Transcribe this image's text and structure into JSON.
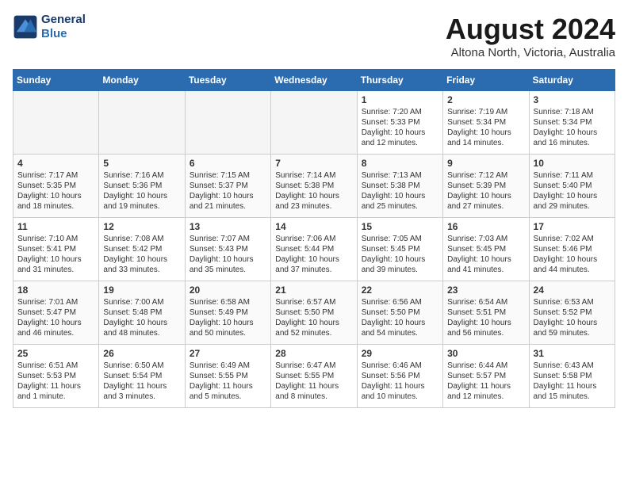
{
  "header": {
    "logo_line1": "General",
    "logo_line2": "Blue",
    "month_title": "August 2024",
    "subtitle": "Altona North, Victoria, Australia"
  },
  "days_of_week": [
    "Sunday",
    "Monday",
    "Tuesday",
    "Wednesday",
    "Thursday",
    "Friday",
    "Saturday"
  ],
  "weeks": [
    [
      {
        "day": "",
        "content": ""
      },
      {
        "day": "",
        "content": ""
      },
      {
        "day": "",
        "content": ""
      },
      {
        "day": "",
        "content": ""
      },
      {
        "day": "1",
        "content": "Sunrise: 7:20 AM\nSunset: 5:33 PM\nDaylight: 10 hours\nand 12 minutes."
      },
      {
        "day": "2",
        "content": "Sunrise: 7:19 AM\nSunset: 5:34 PM\nDaylight: 10 hours\nand 14 minutes."
      },
      {
        "day": "3",
        "content": "Sunrise: 7:18 AM\nSunset: 5:34 PM\nDaylight: 10 hours\nand 16 minutes."
      }
    ],
    [
      {
        "day": "4",
        "content": "Sunrise: 7:17 AM\nSunset: 5:35 PM\nDaylight: 10 hours\nand 18 minutes."
      },
      {
        "day": "5",
        "content": "Sunrise: 7:16 AM\nSunset: 5:36 PM\nDaylight: 10 hours\nand 19 minutes."
      },
      {
        "day": "6",
        "content": "Sunrise: 7:15 AM\nSunset: 5:37 PM\nDaylight: 10 hours\nand 21 minutes."
      },
      {
        "day": "7",
        "content": "Sunrise: 7:14 AM\nSunset: 5:38 PM\nDaylight: 10 hours\nand 23 minutes."
      },
      {
        "day": "8",
        "content": "Sunrise: 7:13 AM\nSunset: 5:38 PM\nDaylight: 10 hours\nand 25 minutes."
      },
      {
        "day": "9",
        "content": "Sunrise: 7:12 AM\nSunset: 5:39 PM\nDaylight: 10 hours\nand 27 minutes."
      },
      {
        "day": "10",
        "content": "Sunrise: 7:11 AM\nSunset: 5:40 PM\nDaylight: 10 hours\nand 29 minutes."
      }
    ],
    [
      {
        "day": "11",
        "content": "Sunrise: 7:10 AM\nSunset: 5:41 PM\nDaylight: 10 hours\nand 31 minutes."
      },
      {
        "day": "12",
        "content": "Sunrise: 7:08 AM\nSunset: 5:42 PM\nDaylight: 10 hours\nand 33 minutes."
      },
      {
        "day": "13",
        "content": "Sunrise: 7:07 AM\nSunset: 5:43 PM\nDaylight: 10 hours\nand 35 minutes."
      },
      {
        "day": "14",
        "content": "Sunrise: 7:06 AM\nSunset: 5:44 PM\nDaylight: 10 hours\nand 37 minutes."
      },
      {
        "day": "15",
        "content": "Sunrise: 7:05 AM\nSunset: 5:45 PM\nDaylight: 10 hours\nand 39 minutes."
      },
      {
        "day": "16",
        "content": "Sunrise: 7:03 AM\nSunset: 5:45 PM\nDaylight: 10 hours\nand 41 minutes."
      },
      {
        "day": "17",
        "content": "Sunrise: 7:02 AM\nSunset: 5:46 PM\nDaylight: 10 hours\nand 44 minutes."
      }
    ],
    [
      {
        "day": "18",
        "content": "Sunrise: 7:01 AM\nSunset: 5:47 PM\nDaylight: 10 hours\nand 46 minutes."
      },
      {
        "day": "19",
        "content": "Sunrise: 7:00 AM\nSunset: 5:48 PM\nDaylight: 10 hours\nand 48 minutes."
      },
      {
        "day": "20",
        "content": "Sunrise: 6:58 AM\nSunset: 5:49 PM\nDaylight: 10 hours\nand 50 minutes."
      },
      {
        "day": "21",
        "content": "Sunrise: 6:57 AM\nSunset: 5:50 PM\nDaylight: 10 hours\nand 52 minutes."
      },
      {
        "day": "22",
        "content": "Sunrise: 6:56 AM\nSunset: 5:50 PM\nDaylight: 10 hours\nand 54 minutes."
      },
      {
        "day": "23",
        "content": "Sunrise: 6:54 AM\nSunset: 5:51 PM\nDaylight: 10 hours\nand 56 minutes."
      },
      {
        "day": "24",
        "content": "Sunrise: 6:53 AM\nSunset: 5:52 PM\nDaylight: 10 hours\nand 59 minutes."
      }
    ],
    [
      {
        "day": "25",
        "content": "Sunrise: 6:51 AM\nSunset: 5:53 PM\nDaylight: 11 hours\nand 1 minute."
      },
      {
        "day": "26",
        "content": "Sunrise: 6:50 AM\nSunset: 5:54 PM\nDaylight: 11 hours\nand 3 minutes."
      },
      {
        "day": "27",
        "content": "Sunrise: 6:49 AM\nSunset: 5:55 PM\nDaylight: 11 hours\nand 5 minutes."
      },
      {
        "day": "28",
        "content": "Sunrise: 6:47 AM\nSunset: 5:55 PM\nDaylight: 11 hours\nand 8 minutes."
      },
      {
        "day": "29",
        "content": "Sunrise: 6:46 AM\nSunset: 5:56 PM\nDaylight: 11 hours\nand 10 minutes."
      },
      {
        "day": "30",
        "content": "Sunrise: 6:44 AM\nSunset: 5:57 PM\nDaylight: 11 hours\nand 12 minutes."
      },
      {
        "day": "31",
        "content": "Sunrise: 6:43 AM\nSunset: 5:58 PM\nDaylight: 11 hours\nand 15 minutes."
      }
    ]
  ]
}
